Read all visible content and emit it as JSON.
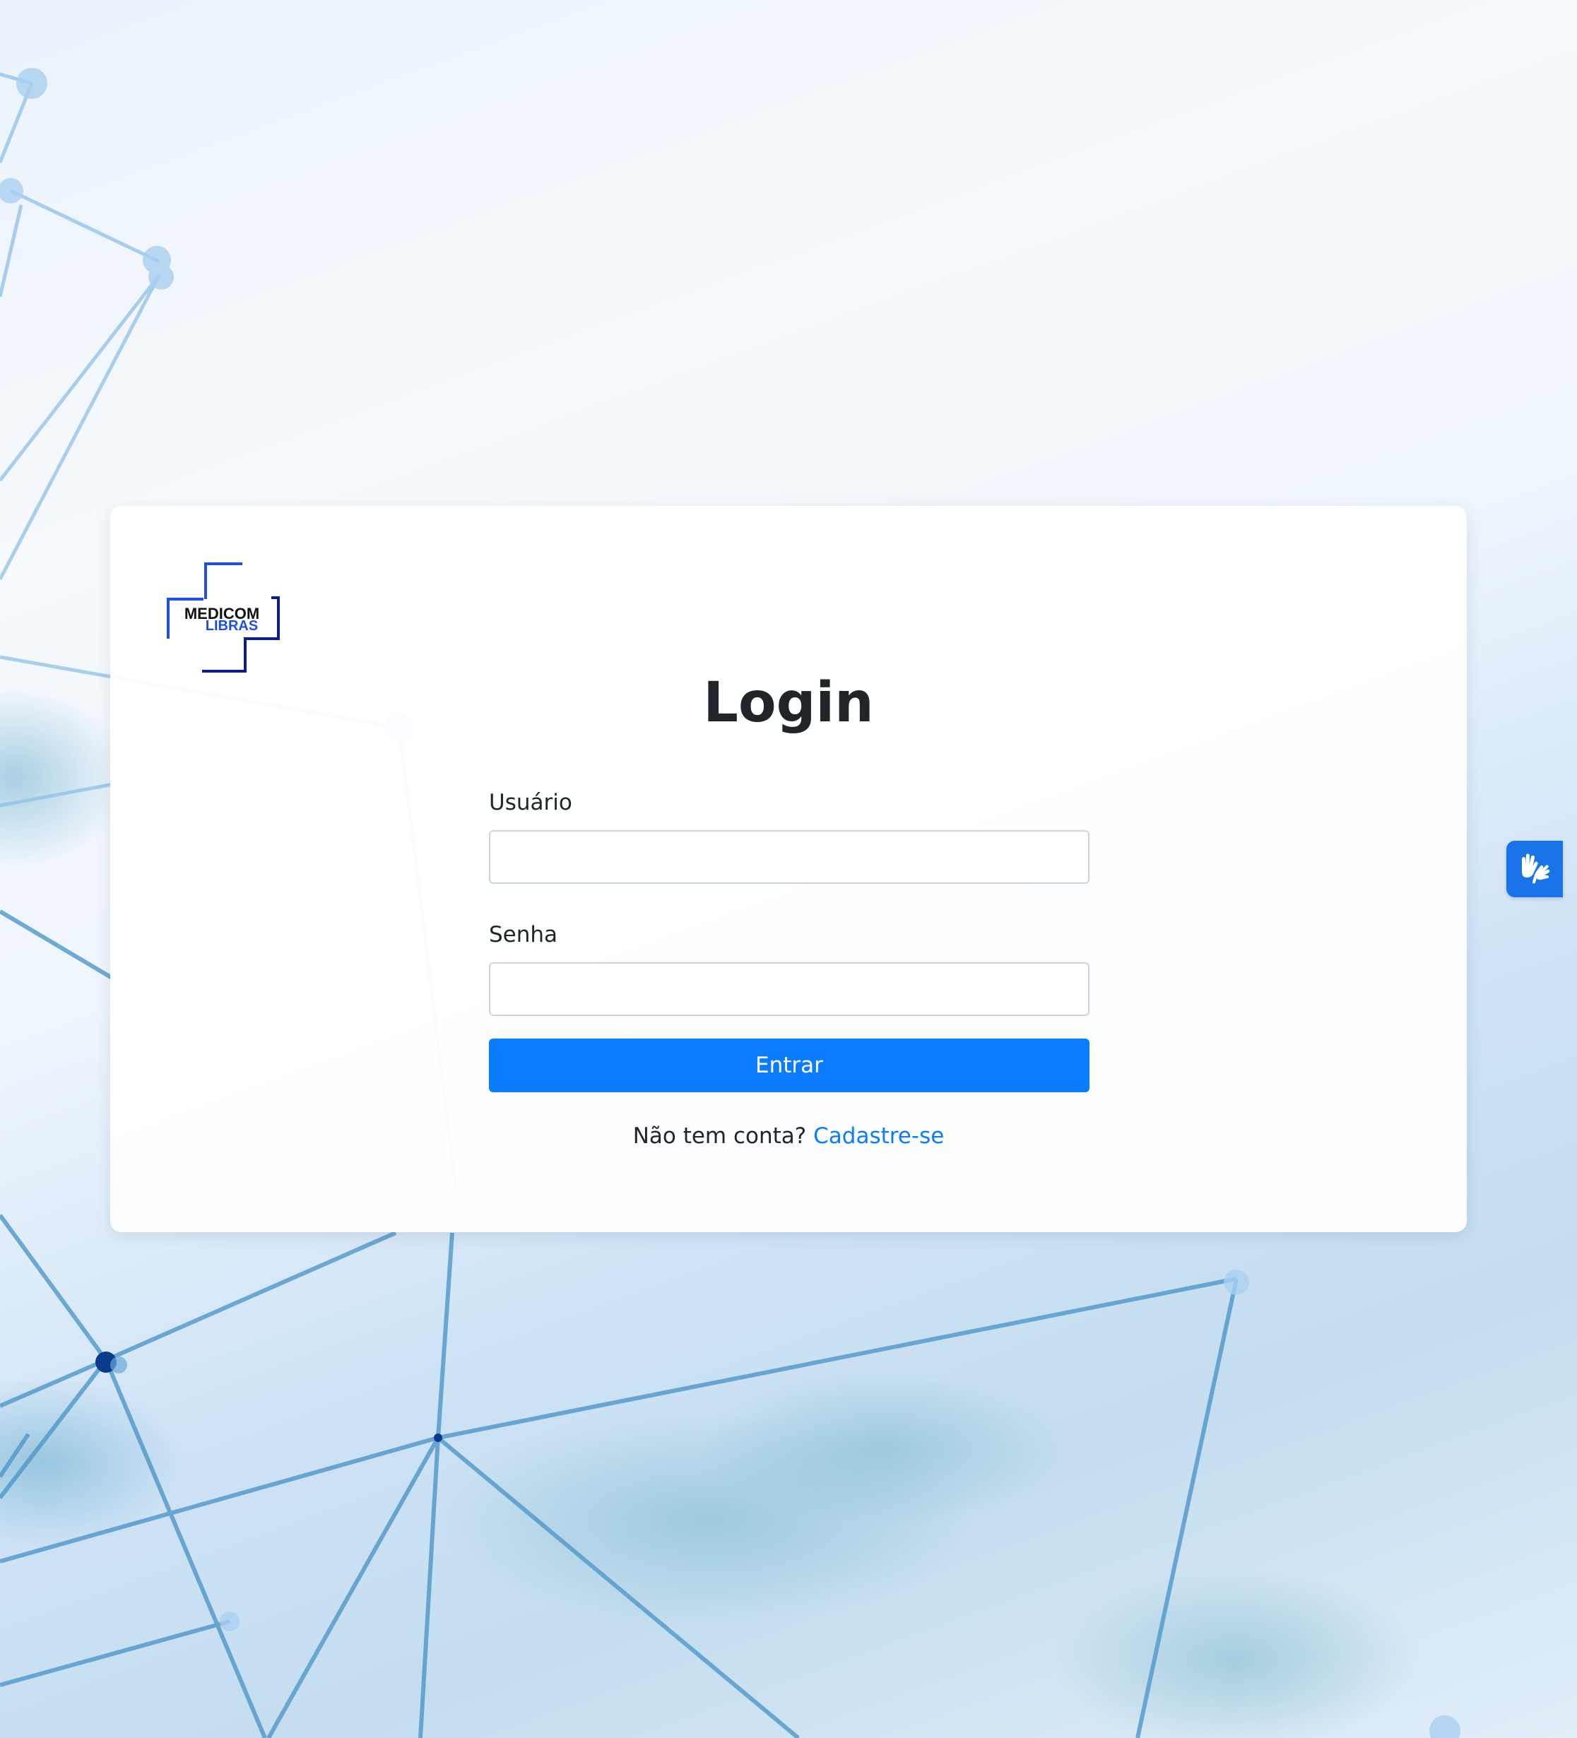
{
  "logo": {
    "line1": "MEDICOM",
    "line2": "LIBRAS"
  },
  "login": {
    "title": "Login",
    "username_label": "Usuário",
    "username_value": "",
    "password_label": "Senha",
    "password_value": "",
    "submit_label": "Entrar",
    "signup_prompt": "Não tem conta?",
    "signup_link": "Cadastre-se"
  },
  "accessibility": {
    "icon": "sign-language-hands-icon"
  },
  "colors": {
    "primary": "#0a7cff",
    "text": "#212529",
    "logo_dark": "#0b1e8c",
    "logo_blue": "#1f4fe0",
    "accessibility_button": "#1a73e8"
  }
}
